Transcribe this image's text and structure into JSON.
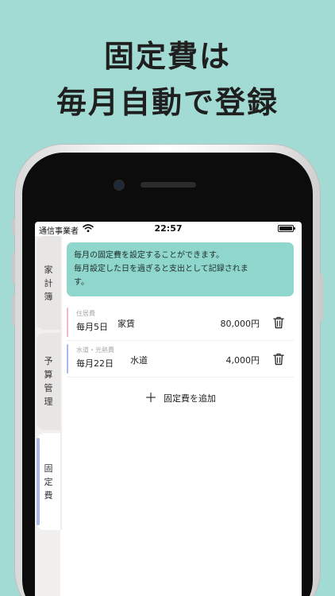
{
  "headline": {
    "line1": "固定費は",
    "line2": "毎月自動で登録"
  },
  "status_bar": {
    "carrier": "通信事業者",
    "time": "22:57"
  },
  "tabs": [
    {
      "label_chars": [
        "家",
        "計",
        "簿"
      ],
      "accent": "#d9d9d9"
    },
    {
      "label_chars": [
        "予",
        "算",
        "管",
        "理"
      ],
      "accent": "#d9d9d9"
    },
    {
      "label_chars": [
        "固",
        "定",
        "費"
      ],
      "accent": "#a9b9f0"
    }
  ],
  "info": {
    "line1": "毎月の固定費を設定することができます。",
    "line2": "毎月設定した日を過ぎると支出として記録されま",
    "line3": "す。"
  },
  "fixed_costs": [
    {
      "category": "住居費",
      "day": "毎月5日",
      "name": "家賃",
      "amount": "80,000円",
      "accent": "#f2b8d0"
    },
    {
      "category": "水道・光熱費",
      "day": "毎月22日",
      "name": "水道",
      "amount": "4,000円",
      "accent": "#a9b9f0"
    }
  ],
  "add_button": {
    "label": "固定費を追加"
  },
  "colors": {
    "background": "#a2dbd3",
    "info_box": "#8fd6cc"
  }
}
